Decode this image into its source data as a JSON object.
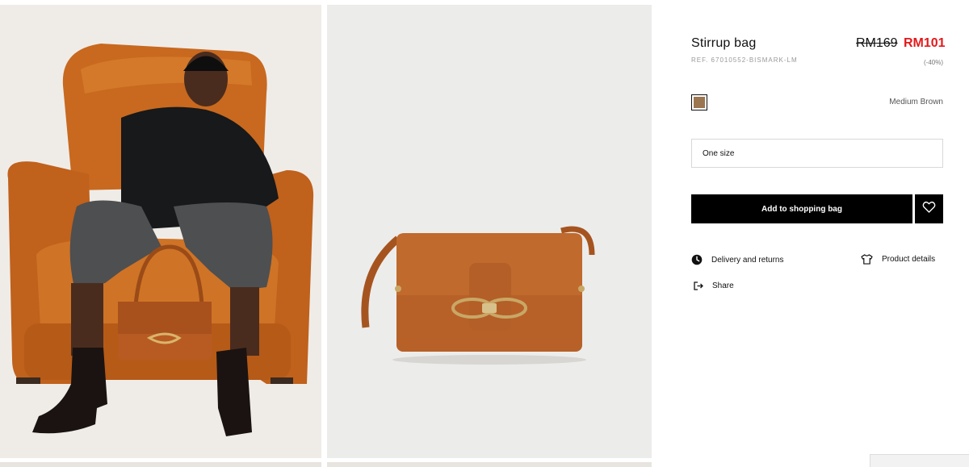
{
  "product": {
    "title": "Stirrup bag",
    "reference": "REF. 67010552-BISMARK-LM",
    "price_original": "RM169",
    "price_sale": "RM101",
    "discount": "(-40%)"
  },
  "color": {
    "name": "Medium Brown",
    "swatch_hex": "#9c7650"
  },
  "size": {
    "selected": "One size"
  },
  "actions": {
    "add_to_bag": "Add to shopping bag",
    "favorite_icon": "heart-icon"
  },
  "links": {
    "delivery": "Delivery and returns",
    "delivery_icon": "clock-icon",
    "details": "Product details",
    "details_icon": "tshirt-icon",
    "share": "Share",
    "share_icon": "share-arrow-icon"
  },
  "colors": {
    "sale_red": "#e3191b",
    "button_black": "#000000",
    "leather": "#b8642a"
  }
}
